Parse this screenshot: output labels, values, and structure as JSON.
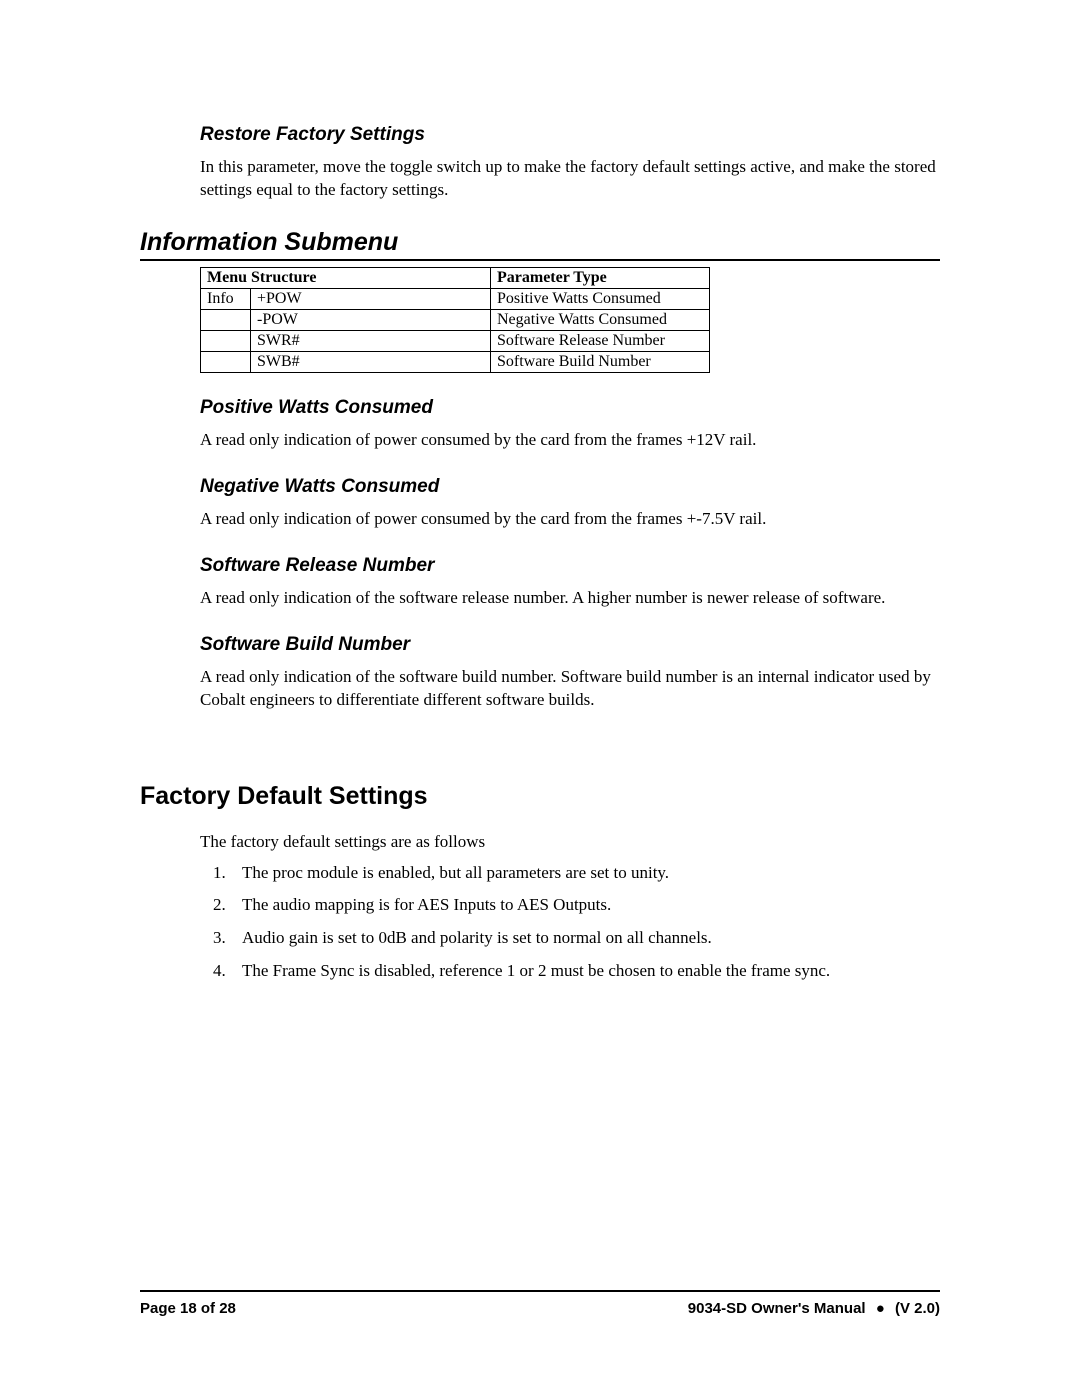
{
  "sections": {
    "restore": {
      "heading": "Restore Factory Settings",
      "body": "In this parameter, move the toggle switch up to make the factory default settings active, and make the stored settings equal to the factory settings."
    },
    "info_submenu": {
      "heading": "Information Submenu",
      "table": {
        "head1": "Menu Structure",
        "head2": "Parameter Type",
        "rows": [
          {
            "c1": "Info",
            "c2": "+POW",
            "c3": "Positive Watts Consumed"
          },
          {
            "c1": "",
            "c2": "-POW",
            "c3": "Negative Watts Consumed"
          },
          {
            "c1": "",
            "c2": "SWR#",
            "c3": "Software Release Number"
          },
          {
            "c1": "",
            "c2": "SWB#",
            "c3": "Software Build Number"
          }
        ]
      }
    },
    "pos_watts": {
      "heading": "Positive Watts Consumed",
      "body": "A read only indication of power consumed by the card from the frames +12V rail."
    },
    "neg_watts": {
      "heading": "Negative Watts Consumed",
      "body": "A read only indication of power consumed by the card from the frames +-7.5V rail."
    },
    "sw_release": {
      "heading": "Software Release Number",
      "body": "A read only indication of the software release number. A higher number is newer release of software."
    },
    "sw_build": {
      "heading": "Software Build Number",
      "body": "A read only indication of the software build number. Software build number is an internal indicator used by Cobalt engineers to differentiate different software builds."
    },
    "factory_defaults": {
      "heading": "Factory Default Settings",
      "intro": "The factory default settings are as follows",
      "items": [
        "The proc module is enabled, but all parameters are set to unity.",
        "The audio mapping is for AES Inputs to AES Outputs.",
        "Audio gain is set to 0dB and polarity is set to normal on all channels.",
        "The Frame Sync is disabled, reference 1 or 2 must be chosen to enable the frame sync."
      ]
    }
  },
  "footer": {
    "page": "Page 18 of 28",
    "manual": "9034-SD Owner's Manual",
    "bullet": "●",
    "version": "(V 2.0)"
  }
}
